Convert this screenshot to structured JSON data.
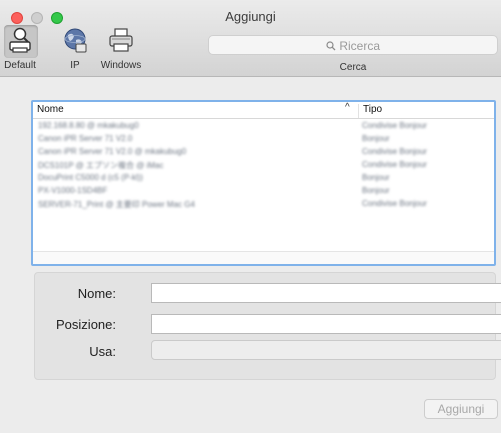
{
  "window": {
    "title": "Aggiungi"
  },
  "toolbar": {
    "items": [
      {
        "label": "Default",
        "icon": "default-printer-icon",
        "selected": true
      },
      {
        "label": "IP",
        "icon": "globe-icon",
        "selected": false
      },
      {
        "label": "Windows",
        "icon": "printer-icon",
        "selected": false
      }
    ],
    "search": {
      "placeholder": "Ricerca",
      "caption": "Cerca"
    }
  },
  "printer_list": {
    "columns": {
      "name": "Nome",
      "type": "Tipo"
    },
    "sort_indicator": "^",
    "rows": [
      {
        "name": "192.168.8.80 @ mkakubug0",
        "type": "Condivise Bonjour"
      },
      {
        "name": "Canon iPR Server 71 V2.0",
        "type": "Bonjour"
      },
      {
        "name": "Canon iPR Server 71 V2.0 @ mkakubug0",
        "type": "Condivise Bonjour"
      },
      {
        "name": "DCS101P @ エプソン複合 @ iMac",
        "type": "Condivise Bonjour"
      },
      {
        "name": "DocuPrint C5000 d (c5 (P-kl))",
        "type": "Bonjour"
      },
      {
        "name": "PX-V1000-1SD4BF",
        "type": "Bonjour"
      },
      {
        "name": "SERVER-71_Print @ 主要印 Power Mac G4",
        "type": "Condivise Bonjour"
      }
    ],
    "rows_obscured": true
  },
  "form": {
    "name_label": "Nome:",
    "name_value": "",
    "location_label": "Posizione:",
    "location_value": "",
    "use_label": "Usa:",
    "use_value": ""
  },
  "add_button": {
    "label": "Aggiungi",
    "enabled": false
  },
  "colors": {
    "close": "#fc605c",
    "minimize_inactive": "#cfcfcf",
    "zoom": "#34c84a",
    "focus_ring": "#7fb2ea",
    "blurred_text": "#6d7683"
  }
}
